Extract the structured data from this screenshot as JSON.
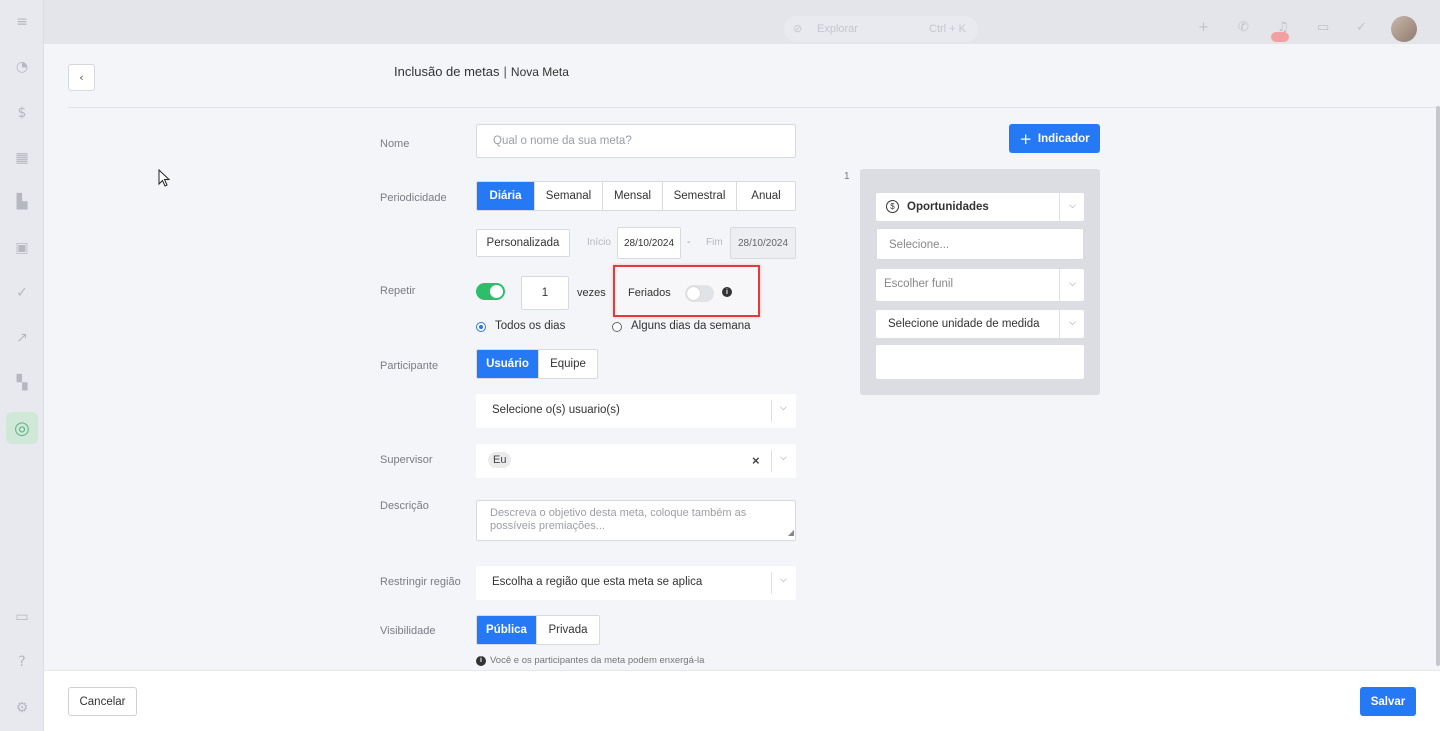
{
  "app": {
    "search_placeholder": "Explorar",
    "search_shortcut": "Ctrl + K"
  },
  "header": {
    "title": "Inclusão de metas",
    "separator": "|",
    "subtitle": "Nova Meta"
  },
  "form": {
    "name": {
      "label": "Nome",
      "placeholder": "Qual o nome da sua meta?"
    },
    "periodicity": {
      "label": "Periodicidade",
      "options": [
        "Diária",
        "Semanal",
        "Mensal",
        "Semestral",
        "Anual"
      ],
      "selected": "Diária",
      "custom_label": "Personalizada",
      "start_label": "Início",
      "start_value": "28/10/2024",
      "dash": "-",
      "end_label": "Fim",
      "end_value": "28/10/2024"
    },
    "repeat": {
      "label": "Repetir",
      "enabled": true,
      "count": "1",
      "times_label": "vezes",
      "holidays_label": "Feriados",
      "holidays_enabled": false,
      "info_icon": "i",
      "radio_all": "Todos os dias",
      "radio_some": "Alguns dias da semana",
      "selected_radio": "Todos os dias"
    },
    "participant": {
      "label": "Participante",
      "options": [
        "Usuário",
        "Equipe"
      ],
      "selected": "Usuário",
      "select_placeholder": "Selecione o(s) usuario(s)"
    },
    "supervisor": {
      "label": "Supervisor",
      "chip": "Eu",
      "clear": "×"
    },
    "description": {
      "label": "Descrição",
      "placeholder": "Descreva o objetivo desta meta, coloque também as possíveis premiações..."
    },
    "region": {
      "label": "Restringir região",
      "placeholder": "Escolha a região que esta meta se aplica"
    },
    "visibility": {
      "label": "Visibilidade",
      "options": [
        "Pública",
        "Privada"
      ],
      "selected": "Pública",
      "info": "Você e os participantes da meta podem enxergá-la"
    }
  },
  "indicator": {
    "add_label": "Indicador",
    "number": "1",
    "type": "Oportunidades",
    "type_icon": "$",
    "select_placeholder": "Selecione...",
    "funnel_placeholder": "Escolher funil",
    "unit_placeholder": "Selecione unidade de medida",
    "value": ""
  },
  "footer": {
    "cancel": "Cancelar",
    "save": "Salvar"
  },
  "colors": {
    "primary": "#2579f5",
    "toggle_on": "#2ebd6b",
    "highlight": "#e33b3b"
  }
}
